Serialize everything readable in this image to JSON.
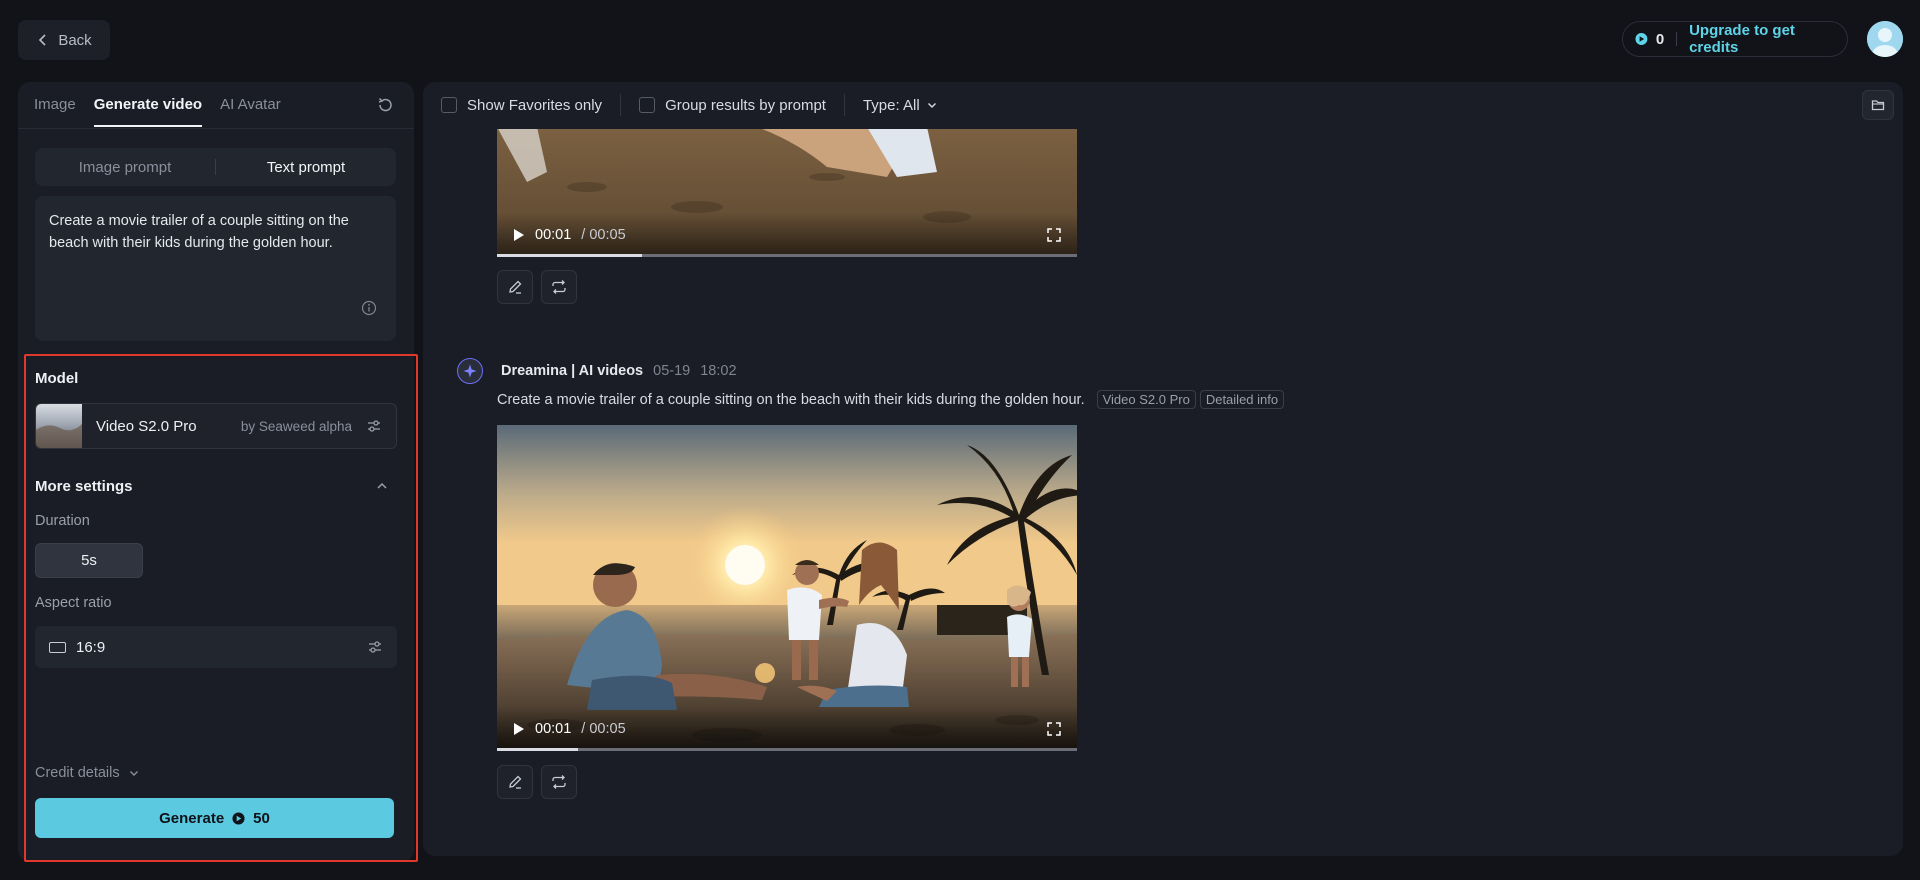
{
  "topbar": {
    "back_label": "Back",
    "credits_count": "0",
    "upgrade_label": "Upgrade to get credits"
  },
  "left": {
    "tabs": [
      {
        "label": "Image",
        "active": false
      },
      {
        "label": "Generate video",
        "active": true
      },
      {
        "label": "AI Avatar",
        "active": false
      }
    ],
    "prompt_modes": {
      "image": "Image prompt",
      "text": "Text prompt"
    },
    "prompt_text": "Create a movie trailer of a couple sitting on the beach with their kids during the golden hour.",
    "model_label": "Model",
    "model": {
      "name": "Video S2.0 Pro",
      "by": "by Seaweed alpha"
    },
    "more_settings_label": "More settings",
    "duration_label": "Duration",
    "duration_value": "5s",
    "aspect_label": "Aspect ratio",
    "aspect_value": "16:9",
    "credit_details_label": "Credit details",
    "generate_label": "Generate",
    "generate_cost": "50"
  },
  "main": {
    "toolbar": {
      "favorites_label": "Show Favorites only",
      "group_label": "Group results by prompt",
      "type_label": "Type: All"
    },
    "video_top": {
      "current": "00:01",
      "duration": "/ 00:05",
      "progress": 0.25
    },
    "entry": {
      "source": "Dreamina | AI videos",
      "date": "05-19",
      "time": "18:02",
      "prompt": "Create a movie trailer of a couple sitting on the beach with their kids during the golden hour.",
      "tags": [
        "Video S2.0 Pro",
        "Detailed info"
      ]
    },
    "video_main": {
      "current": "00:01",
      "duration": "/ 00:05",
      "progress": 0.14
    }
  },
  "colors": {
    "accent": "#5bc9e0",
    "highlight": "#e0382b",
    "link": "#5fd3e8"
  }
}
